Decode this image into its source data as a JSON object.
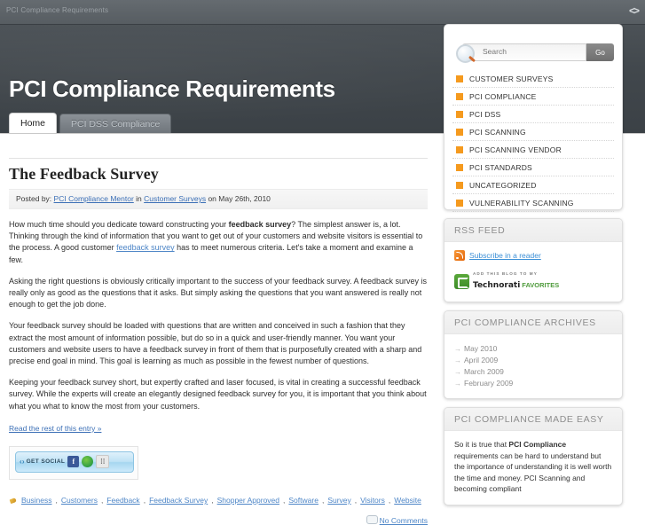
{
  "chrome": {
    "title": "PCI Compliance Requirements",
    "code_icon": "<>"
  },
  "header": {
    "site_title": "PCI Compliance Requirements"
  },
  "tabs": [
    {
      "label": "Home",
      "active": true
    },
    {
      "label": "PCI DSS Compliance",
      "active": false
    }
  ],
  "post": {
    "title": "The Feedback Survey",
    "meta": {
      "posted_by_label": "Posted by:",
      "author": "PCI Compliance Mentor",
      "in_label": "in",
      "category": "Customer Surveys",
      "date_prefix": "on",
      "date": "May 26th, 2010"
    },
    "paragraph_1_a": "How much time should you dedicate toward constructing your ",
    "paragraph_1_bold": "feedback survey",
    "paragraph_1_b": "? The simplest answer is, a lot. Thinking through the kind of information that you want to get out of your customers and website visitors is essential to the process. A good customer ",
    "paragraph_1_link": "feedback survey",
    "paragraph_1_c": " has to meet numerous criteria. Let's take a moment and examine a few.",
    "paragraph_2": "Asking the right questions is obviously critically important to the success of your feedback survey. A feedback survey is really only as good as the questions that it asks. But simply asking the questions that you want answered is really not enough to get the job done.",
    "paragraph_3": "Your feedback survey should be loaded with questions that are written and conceived in such a fashion that they extract the most amount of information possible, but do so in a quick and user-friendly manner. You want your customers and website users to have a feedback survey in front of them that is purposefully created with a sharp and precise end goal in mind. This goal is learning as much as possible in the fewest number of questions.",
    "paragraph_4": "Keeping your feedback survey short, but expertly crafted and laser focused, is vital in creating a successful feedback survey. While the experts will create an elegantly designed feedback survey for you, it is important that you think about what you what to know the most from your customers.",
    "read_more": "Read the rest of this entry »"
  },
  "social": {
    "label": "GET SOCIAL",
    "chevrons": "‹ ›",
    "icons": [
      {
        "name": "facebook",
        "glyph": "f"
      },
      {
        "name": "stumbleupon",
        "glyph": ""
      },
      {
        "name": "more-share",
        "glyph": "⁞⁞"
      }
    ]
  },
  "tags": [
    "Business",
    "Customers",
    "Feedback",
    "Feedback Survey",
    "Shopper Approved",
    "Software",
    "Survey",
    "Visitors",
    "Website"
  ],
  "comments": {
    "label": "No Comments"
  },
  "sidebar": {
    "search": {
      "placeholder": "Search",
      "value": "",
      "go_label": "Go"
    },
    "categories": [
      "CUSTOMER SURVEYS",
      "PCI COMPLIANCE",
      "PCI DSS",
      "PCI SCANNING",
      "PCI SCANNING VENDOR",
      "PCI STANDARDS",
      "UNCATEGORIZED",
      "VULNERABILITY SCANNING"
    ],
    "rss": {
      "heading": "RSS FEED",
      "link_label": "Subscribe in a reader",
      "technorati_top": "ADD THIS BLOG TO MY",
      "technorati_name": "Technorati",
      "technorati_fav": "FAVORITES"
    },
    "archives": {
      "heading": "PCI COMPLIANCE ARCHIVES",
      "items": [
        "May 2010",
        "April 2009",
        "March 2009",
        "February 2009"
      ]
    },
    "easy": {
      "heading": "PCI COMPLIANCE MADE EASY",
      "text_a": "So it is true that ",
      "text_bold": "PCI Compliance",
      "text_b": " requirements can be hard to understand but the importance of understanding it is well worth the time and money. PCI Scanning and becoming compliant"
    }
  },
  "colors": {
    "accent_orange": "#f59a1e",
    "link_blue": "#4e86c7",
    "header_dark": "#42484d"
  }
}
